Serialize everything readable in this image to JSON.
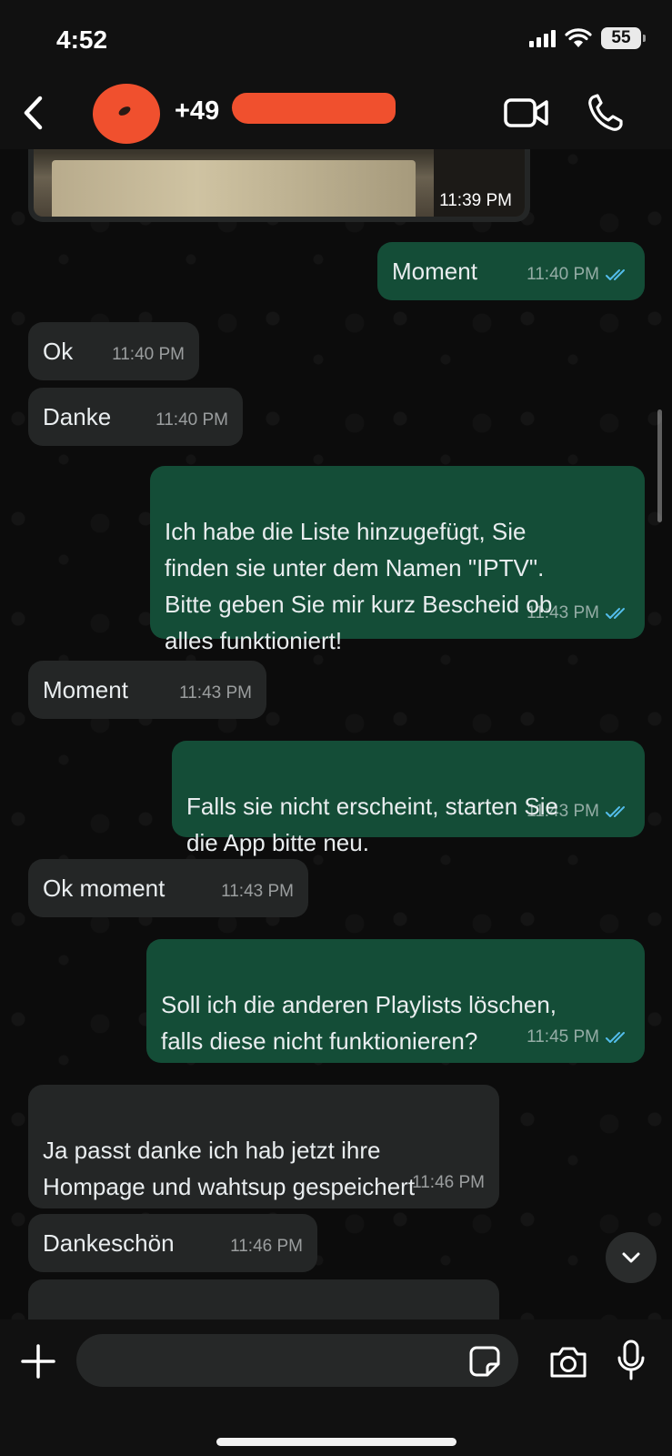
{
  "status_bar": {
    "time": "4:52",
    "battery": "55"
  },
  "header": {
    "contact_name": "+49"
  },
  "image_message": {
    "time": "11:39 PM"
  },
  "messages": [
    {
      "direction": "out",
      "text": "Moment",
      "time": "11:40 PM"
    },
    {
      "direction": "in",
      "text": "Ok",
      "time": "11:40 PM"
    },
    {
      "direction": "in",
      "text": "Danke",
      "time": "11:40 PM"
    },
    {
      "direction": "out",
      "text": "Ich habe die Liste hinzugefügt, Sie\nfinden sie unter dem Namen \"IPTV\".\nBitte geben Sie mir kurz Bescheid ob\nalles funktioniert!",
      "time": "11:43 PM"
    },
    {
      "direction": "in",
      "text": "Moment",
      "time": "11:43 PM"
    },
    {
      "direction": "out",
      "text": "Falls sie nicht erscheint, starten Sie\ndie App bitte neu.",
      "time": "11:43 PM"
    },
    {
      "direction": "in",
      "text": "Ok moment",
      "time": "11:43 PM"
    },
    {
      "direction": "out",
      "text": "Soll ich die anderen Playlists löschen,\nfalls diese nicht funktionieren?",
      "time": "11:45 PM"
    },
    {
      "direction": "in",
      "text": "Ja passt danke ich hab jetzt ihre\nHompage und wahtsup gespeichert",
      "time": "11:46 PM"
    },
    {
      "direction": "in",
      "text": "Dankeschön",
      "time": "11:46 PM"
    }
  ],
  "input": {
    "placeholder": ""
  },
  "colors": {
    "outgoing_bubble": "#144d37",
    "incoming_bubble": "#242626",
    "read_ticks": "#53bdeb"
  }
}
